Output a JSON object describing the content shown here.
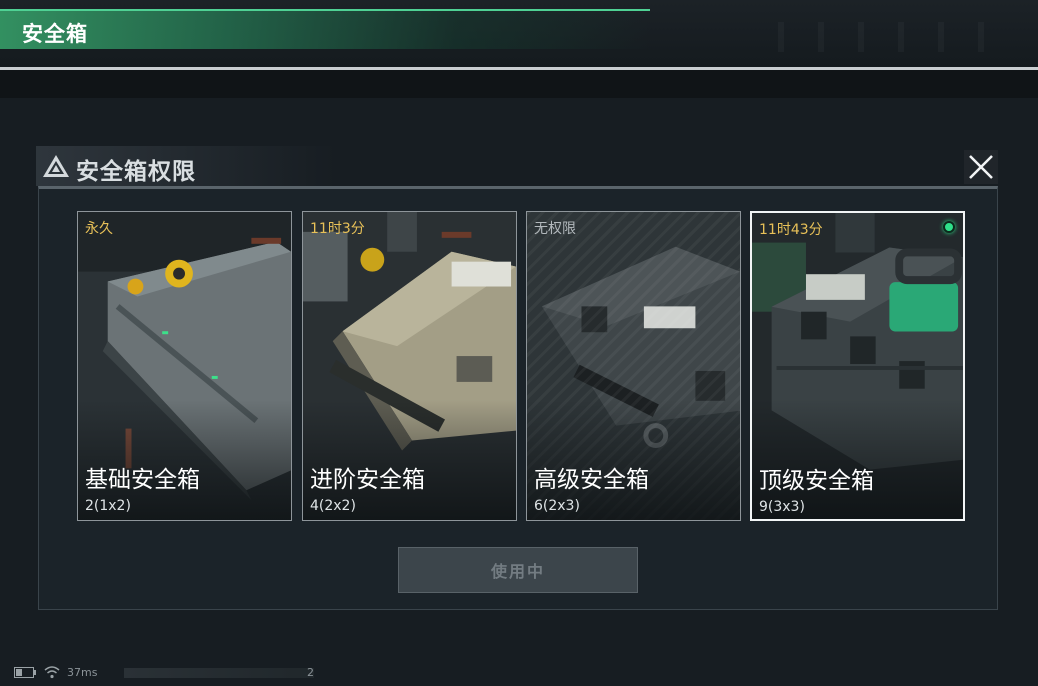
{
  "header": {
    "title": "安全箱"
  },
  "modal": {
    "title": "安全箱权限",
    "icons": {
      "warning": "warning-triangle-icon",
      "close": "close-icon"
    }
  },
  "cards": [
    {
      "status": "永久",
      "name": "基础安全箱",
      "size": "2(1x2)",
      "locked": false,
      "selected": false
    },
    {
      "status": "11时3分",
      "name": "进阶安全箱",
      "size": "4(2x2)",
      "locked": false,
      "selected": false
    },
    {
      "status": "无权限",
      "name": "高级安全箱",
      "size": "6(2x3)",
      "locked": true,
      "selected": false
    },
    {
      "status": "11时43分",
      "name": "顶级安全箱",
      "size": "9(3x3)",
      "locked": false,
      "selected": true
    }
  ],
  "action_button": {
    "label": "使用中"
  },
  "statusbar": {
    "ping": "37ms",
    "page": "2"
  },
  "colors": {
    "accent_green": "#2fe08a",
    "timer_yellow": "#e8c158",
    "header_green": "#3fa872"
  }
}
